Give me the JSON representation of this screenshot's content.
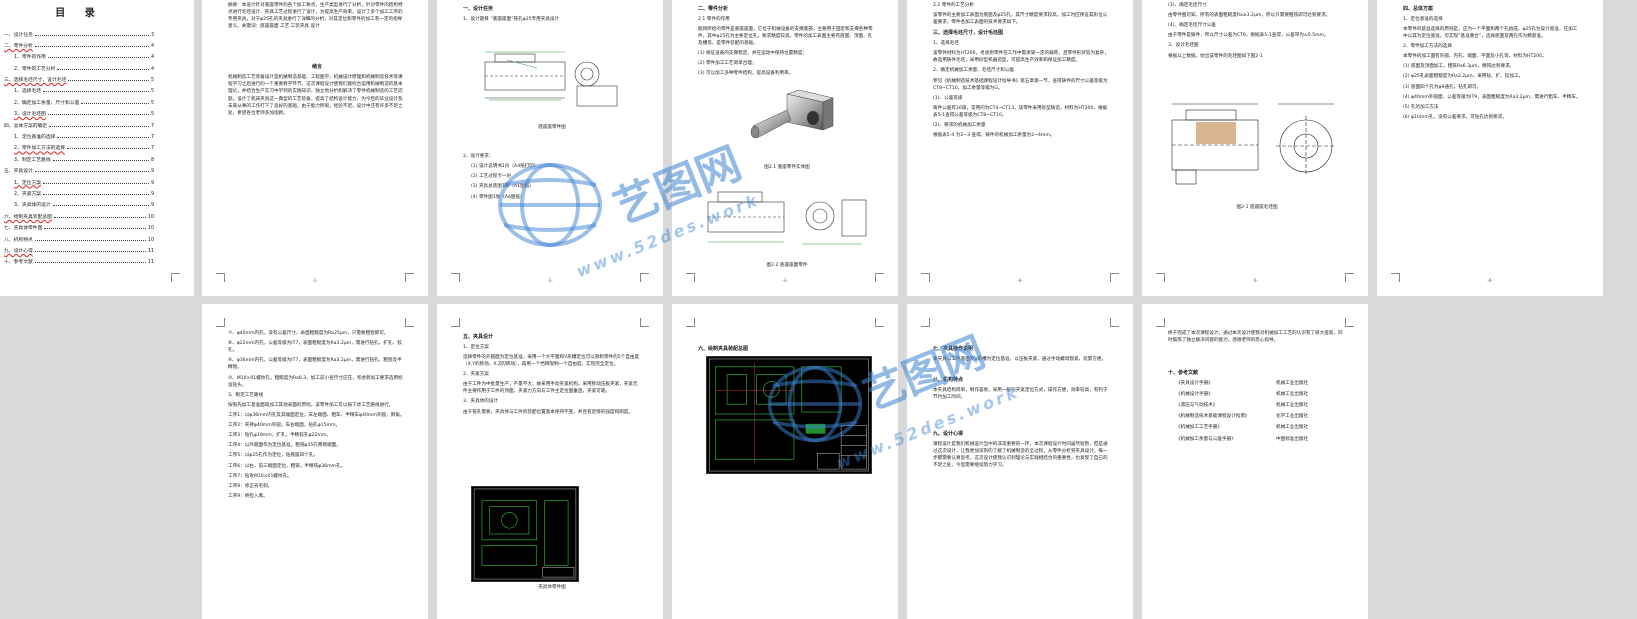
{
  "toc": {
    "title": "目  录",
    "items": [
      {
        "label": "一、设计任务",
        "page": "3",
        "sub": false
      },
      {
        "label": "二、零件分析",
        "page": "4",
        "sub": false
      },
      {
        "label": "1、零件的作用",
        "page": "4",
        "sub": true
      },
      {
        "label": "2、零件的工艺分析",
        "page": "4",
        "sub": true
      },
      {
        "label": "三、选择毛坯尺寸，设计毛坯",
        "page": "5",
        "sub": false
      },
      {
        "label": "1、选择毛坯",
        "page": "5",
        "sub": true
      },
      {
        "label": "2、确定加工余量、尺寸和公差",
        "page": "5",
        "sub": true
      },
      {
        "label": "3、设计毛坯图",
        "page": "5",
        "sub": true
      },
      {
        "label": "四、总体方案的确定",
        "page": "7",
        "sub": false
      },
      {
        "label": "1、定位基准的选择",
        "page": "7",
        "sub": true
      },
      {
        "label": "2、零件加工方法的选择",
        "page": "7",
        "sub": true
      },
      {
        "label": "3、制定工艺路线",
        "page": "8",
        "sub": true
      },
      {
        "label": "五、夹具设计",
        "page": "9",
        "sub": false
      },
      {
        "label": "1、定位方案",
        "page": "9",
        "sub": true
      },
      {
        "label": "2、夹紧方案",
        "page": "9",
        "sub": true
      },
      {
        "label": "3、夹具体的设计",
        "page": "9",
        "sub": true
      },
      {
        "label": "六、绘制夹具装配总图",
        "page": "10",
        "sub": false
      },
      {
        "label": "七、夹具体零件图",
        "page": "10",
        "sub": false
      },
      {
        "label": "八、机构特点",
        "page": "10",
        "sub": false
      },
      {
        "label": "九、设计心得",
        "page": "11",
        "sub": false
      },
      {
        "label": "十、参考文献",
        "page": "11",
        "sub": false
      }
    ]
  },
  "p2": {
    "abstract": "摘要：本设计针对底座零件的各个加工要点，生产类型进行了分析，针对零件的结构特点进行毛坯设计、夹具工艺过程进行了设计，为提高生产效率，设计了多个加工工序的专用夹具，对于φ25孔的夹具进行了详细的分析，对其定位和零件的加工有一定的指导意义。关键词：底座座面 工艺 工装夹具 设计",
    "preface_title": "绪言",
    "preface": "机械制造工艺装备设计是机械制造基础、工程图学、机械设计原理和机械制造技术等课程学习之后进行的一个重要教学环节，这次课程设计使我们能综合运用机械制造的基本理论，并结合生产实习中学到的实践知识，独立地分析和解决了零件机械制造的工艺问题，设计了机床夹具这一典型的工艺装备，提高了结构设计能力，为今后的毕业设计及未来从事的工作打下了良好的基础。由于能力所限，经验不足，设计中还有许多不足之处，希望各位老师多加指教。",
    "page_no": "-1-"
  },
  "p3": {
    "section": "一、设计任务",
    "subline": "1、设计题目  “底座座面”铣孔φ25专用夹具设计",
    "fig1_caption": "底座座零件图",
    "list_head": "2、设计要求：",
    "list": [
      "(1) 设计说明书1份（A4纸打印）",
      "(2) 工艺过程卡一份",
      "(3) 夹具总装图1张（A1图纸）",
      "(4) 零件图1张（A4图纸）"
    ],
    "page_no": "-2-"
  },
  "p4": {
    "section": "二、零件分析",
    "sub": "2.1 零件的作用",
    "body": "题目所给的零件是底座座面，它位于机械设备的支撑底部，主要用于固定和支撑各种零件，其中φ25孔为主要定位孔，要求精度较高。零件的加工表面主要有底面、顶面、孔及槽等，是零件装配的基础。",
    "list": [
      "(1) 保证设备的支撑稳定，并在运动中保持位置精度；",
      "(2) 零件加工工艺简单合理；",
      "(3) 可以加工多种零件结构，提高设备利用率。"
    ],
    "fig1_caption": "图2.1 底座零件实体图",
    "fig2_caption": "图2.2 底座座面零件",
    "page_no": "-3-"
  },
  "p5": {
    "sub": "2.2 零件的工艺分析",
    "body": "该零件的主要加工表面为底面及φ25孔，其尺寸精度要求较高，加工时应保证其形位公差要求，零件各加工表面的技术要求如下。",
    "section": "三、选择毛坯尺寸，设计毛坯图",
    "sub2": "1、选择毛坯",
    "body2": "该零件材料为HT200，考虑到零件在工作中需承受一定的载荷，且零件形状较为复杂，故选用铸件毛坯，采用砂型机器造型，可提高生产效率和保证加工精度。",
    "sub3": "2、确定机械加工余量、毛坯尺寸和公差",
    "body3": "参见《机械制造技术基础课程设计指导书》第五章第一节，查得铸件的尺寸公差等级为CT8~CT10，加工余量等级为G。",
    "sub4": "(1)、公差等级",
    "body4": "铸件公差有16级，常用的为CT4~CT13，该零件采用砂型铸造，材料为HT200，根据表5-1查得公差等级为CT8~CT10。",
    "sub5": "(2)、要求的机械加工余量",
    "body5": "根据表5-4 为2~3 查得，铸件的机械加工余量为2~4mm。",
    "page_no": "-4-"
  },
  "p6": {
    "item1": "(3)、确定毛坯尺寸",
    "body1": "由零件图可知，所有的表面粗糙度Ra≥3.2μm，所以只需要粗铣即可达到要求。",
    "item2": "(4)、确定毛坯尺寸公差",
    "body2": "由于零件是铸件，所以尺寸公差为CT9，根据表5-1查得，公差带为±0.5mm。",
    "item3": "3、设计毛坯图",
    "body3": "根据以上数据，绘出该零件的毛坯图如下图2-1",
    "fig_caption": "图2-1 底座座毛坯图",
    "page_no": "-5-"
  },
  "p7": {
    "section": "四、总体方案",
    "sub": "1、定位基准的选择",
    "body": "本零件的基准选择的原则是，应为一个平面和两个孔组成，φ25孔为设计基准，在加工中以其为定位基准，可实现“基准重合”，选择底面及两孔作为精基准。",
    "sub2": "2、零件加工方法的选择",
    "body2": "本零件的加工面有外圆、内孔、端面、平面及小孔等，材料为HT200。",
    "list": [
      "(1) 底面及顶面加工，粗铣Ra6.3μm，精铣达到要求。",
      "(2) φ25孔表面粗糙度为Ra3.2μm，采用钻、扩、铰加工。",
      "(3) 底面四个孔为φ9通孔，钻孔即可。",
      "(4) φ40mm外圆面，公差等级为IT9，表面粗糙度为Ra3.2μm，需进行粗车、半精车。",
      "(5) 孔的加工方法",
      "(6) φ10mm孔，没有公差要求，可钻孔达到要求。"
    ],
    "page_no": "-6-"
  },
  "p8": {
    "list": [
      "⑦、φ40mm内孔，没有公差尺寸，表面粗糙度为Ra25μm，只需要粗镗即可。",
      "⑧、φ22mm内孔，公差等级为IT7，表面粗糙度为Ra3.2μm，需进行钻孔、扩孔、铰孔。",
      "⑨、φ36mm内孔，公差等级为IT7，表面粗糙度为Ra3.2μm，需进行钻孔、粗镗及半精镗。",
      "⑩、M10×01螺纹孔，粗糙度为Ra6.3，加工前小径尺寸应在，考虑到加工要求选用标准钻头。"
    ],
    "sub": "3、制定工艺路线",
    "body": "按照先加工基准面再加工其他表面的原则，该零件加工可以按下述工艺路线进行。",
    "steps": [
      "工序1：以φ36mm内孔及其端面定位，车左端面、粗车、半精车φ40mm外圆，倒角。",
      "工序2：夹持φ40mm外圆，车右端面，钻孔φ15mm。",
      "工序3：钻孔φ19mm，扩孔，半精铰孔φ22mm。",
      "工序4：以外圆面作为定位基准，粗铣φ25孔两侧端面。",
      "工序5：以φ25孔作为定位，钻底座四个孔。",
      "工序6：以右，前三端面定位，粗铣，半精铣φ36mm孔。",
      "工序7：钻攻M10×01螺纹孔。",
      "工序8：修正去毛刺。",
      "工序9：终检入库。"
    ],
    "page_no": "-7-"
  },
  "p9": {
    "section": "五、夹具设计",
    "sub": "1、定位方案",
    "body": "选择零件的外圆面为定位基准，采用一个大平面和V形槽定位可以限制零件的5个自由度（X,Y的移动，X,Z的转动），再用一个挡销限制一个自由度，实现完全定位。",
    "sub2": "2、夹紧方案",
    "body2": "由于工件为中批量生产，产量不大，故采用手动夹紧机构。采用移动压板夹紧，夹紧元件主要作用于工件的顶面，夹紧力方向与工件主定位面垂直，夹紧可靠。",
    "sub3": "3、夹具体的设计",
    "body3": "由于铣孔需要，夹具体与工件的装配位置基本保持不变，并且有足够的强度和刚度。",
    "fig_caption": "夹具体零件图",
    "page_no": "-8-"
  },
  "p10": {
    "section": "六、绘制夹具装配总图",
    "page_no": "-9-"
  },
  "p11": {
    "sub": "七、夹具操作说明",
    "body": "本夹具以工件底面及V形槽为定位基准，以压板夹紧，通过手动螺母锁紧，装卸方便。",
    "section2": "八、机构特点",
    "body2": "本夹具结构简单，制作容易，采用一般的夹紧定位方式，操作方便，效率较高，有利于节约加工时间。",
    "section3": "九、设计心得",
    "body3": "课程设计是我们机械设计当中的非常重要的一环，本次课程设计时间虽然短暂，但是通过这次设计，让我更加深刻的了解了机械制造的全过程，从零件分析到夹具设计，每一步都需要认真思考。这次设计使我认识到理论与实践相结合的重要性，也发现了自己的不足之处，今后需要继续努力学习。",
    "page_no": "-10-"
  },
  "p12": {
    "body": "终于完成了本次课程设计，通过本次设计使我对机械加工工艺的认识有了很大提高，同时锻炼了独立解决问题的能力。感谢老师的悉心指导。",
    "section": "十、参考文献",
    "refs": [
      {
        "title": "《夹具设计手册》",
        "pub": "机械工业出版社"
      },
      {
        "title": "《机械设计手册》",
        "pub": "机械工业出版社"
      },
      {
        "title": "《液压与气动技术》",
        "pub": "机械工业出版社"
      },
      {
        "title": "《机械制造技术基础课程设计指南》",
        "pub": "化学工业出版社"
      },
      {
        "title": "《机械加工工艺手册》",
        "pub": "机械工业出版社"
      },
      {
        "title": "《机械加工余量与公差手册》",
        "pub": "中国标准出版社"
      }
    ],
    "page_no": "-11-"
  },
  "watermark": {
    "logo_text": "艺图网",
    "url": "www.52des.work"
  },
  "colors": {
    "background": "#d9d9d9",
    "page": "#ffffff",
    "watermark": "#3c82d2",
    "wavy_underline": "#d22222",
    "cad_green": "#2ecc40"
  }
}
